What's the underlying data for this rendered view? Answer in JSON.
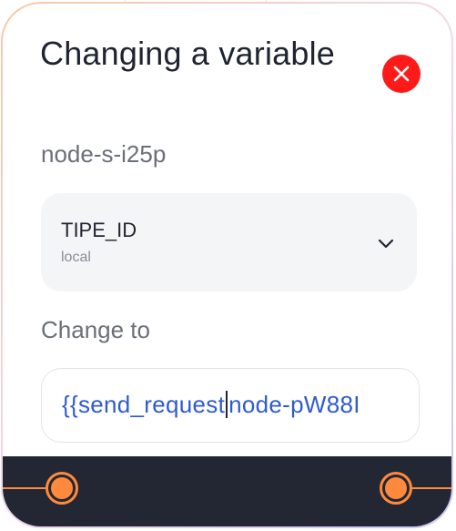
{
  "modal": {
    "title": "Changing a variable",
    "node_id": "node-s-i25p",
    "close_icon": "close-icon"
  },
  "variable_select": {
    "name": "TIPE_ID",
    "scope": "local",
    "icon": "chevron-down-icon"
  },
  "change_to": {
    "label": "Change to",
    "value_before_cursor": "{{send_request",
    "value_after_cursor": "node-pW88I"
  },
  "ports": {
    "input_icon": "input-port-icon",
    "output_icon": "output-port-icon"
  },
  "colors": {
    "close_button": "#ff1a1a",
    "accent_port": "#ff8a3d",
    "value_text": "#2f5bd1",
    "footer_bg": "#222733"
  }
}
